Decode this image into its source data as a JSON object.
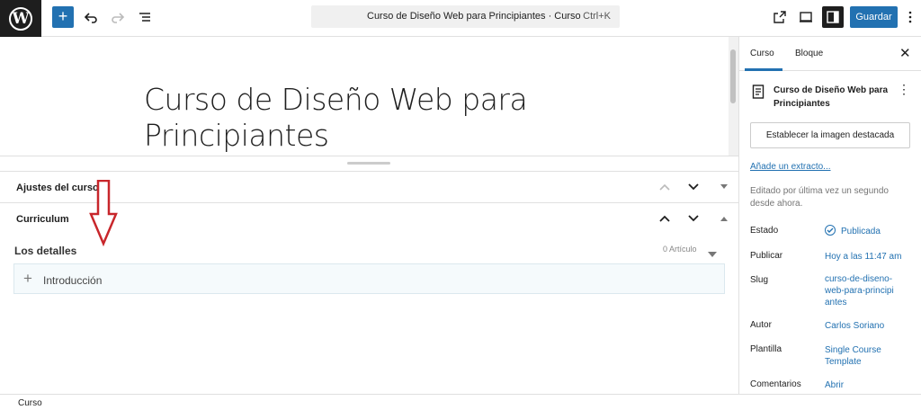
{
  "topbar": {
    "logo": "W",
    "add_block": "+",
    "command_title": "Curso de Diseño Web para Principiantes · Curso",
    "shortcut": "Ctrl+K",
    "save_label": "Guardar"
  },
  "editor": {
    "title_line1": "Curso de Diseño Web para",
    "title_line2": "Principiantes"
  },
  "meta_boxes": {
    "settings_label": "Ajustes del curso",
    "curriculum_label": "Curriculum"
  },
  "curriculum": {
    "section_title": "Los detalles",
    "count": "0 Artículo",
    "lessons": [
      {
        "name": "Introducción"
      }
    ]
  },
  "sidebar": {
    "tabs": [
      "Curso",
      "Bloque"
    ],
    "post_name": "Curso de Diseño Web para Principiantes",
    "featured_button": "Establecer la imagen destacada",
    "excerpt_link": "Añade un extracto...",
    "edited": "Editado por última vez un segundo desde ahora.",
    "rows": [
      {
        "label": "Estado",
        "value": "Publicada"
      },
      {
        "label": "Publicar",
        "value": "Hoy a las 11:47 am"
      },
      {
        "label": "Slug",
        "value": "curso-de-diseno-web-para-principiantes"
      },
      {
        "label": "Autor",
        "value": "Carlos Soriano"
      },
      {
        "label": "Plantilla",
        "value": "Single Course Template"
      },
      {
        "label": "Comentarios",
        "value": "Abrir"
      }
    ]
  },
  "footer": {
    "breadcrumb": "Curso"
  },
  "colors": {
    "accent": "#2271b1",
    "annotation_arrow": "#c8262b"
  }
}
